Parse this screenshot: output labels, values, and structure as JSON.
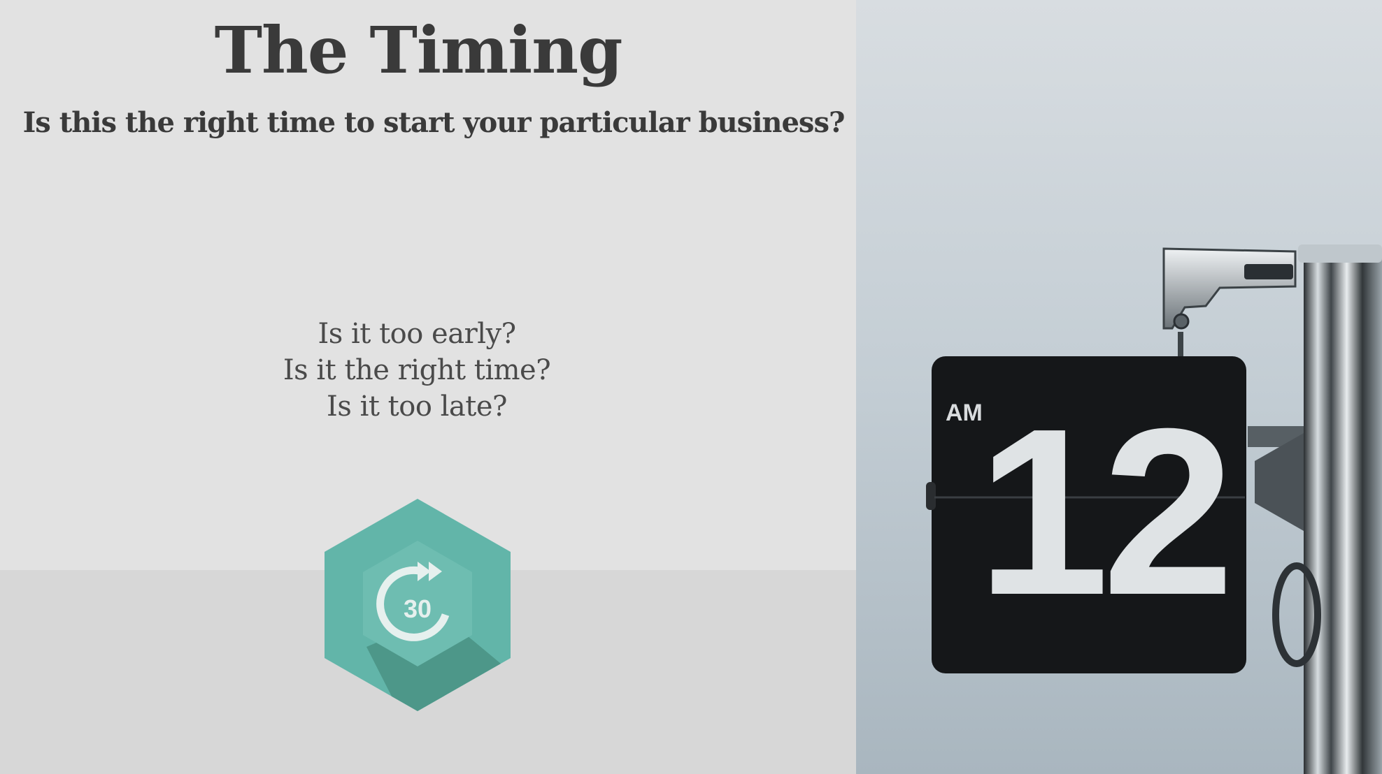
{
  "slide": {
    "title": "The Timing",
    "subtitle": "Is this the right time to start your particular business?",
    "questions": [
      "Is it too early?",
      "Is it the right time?",
      "Is it too late?"
    ],
    "icon": {
      "name": "fast-forward-30-icon",
      "label": "30",
      "color": "#62b5a9",
      "shadow": "#4d9789"
    },
    "photo": {
      "subject": "flip-clock-photo",
      "clock_am": "AM",
      "clock_digits": "12"
    }
  }
}
